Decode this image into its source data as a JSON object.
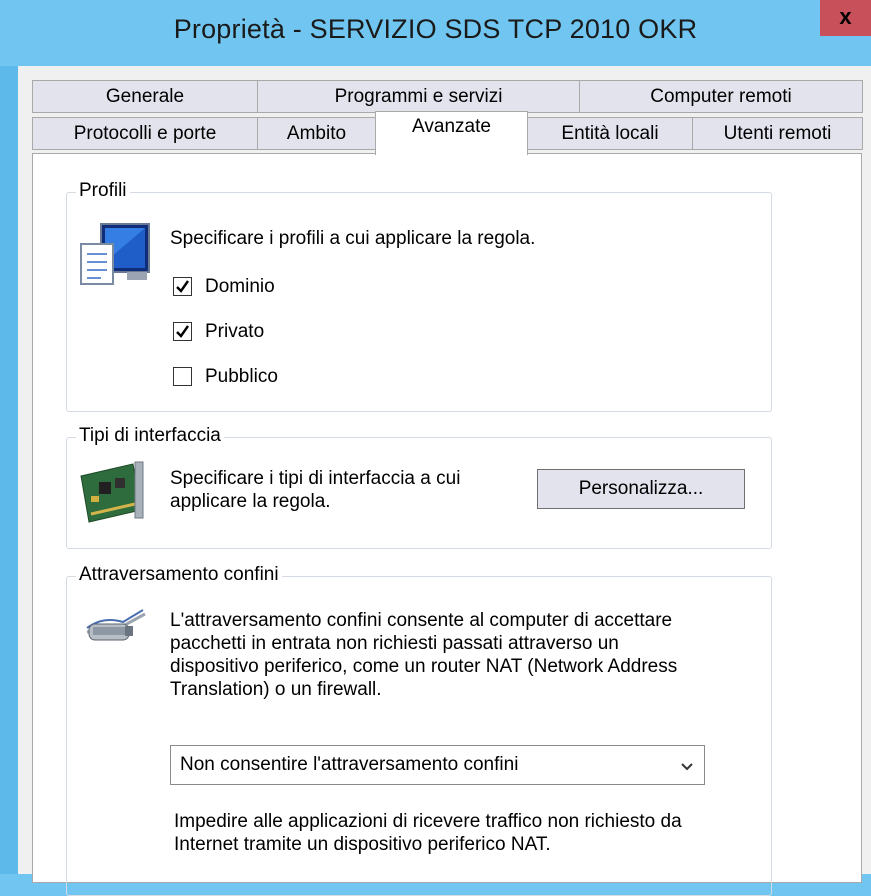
{
  "window": {
    "title": "Proprietà - SERVIZIO SDS TCP 2010 OKR",
    "close_label": "x"
  },
  "tabs": {
    "row1": [
      "Generale",
      "Programmi e servizi",
      "Computer remoti"
    ],
    "row2": [
      "Protocolli e porte",
      "Ambito",
      "Avanzate",
      "Entità locali",
      "Utenti remoti"
    ],
    "selected": "Avanzate"
  },
  "profiles": {
    "title": "Profili",
    "description": "Specificare i profili a cui applicare la regola.",
    "icon": "computer-profile-icon",
    "options": [
      {
        "label": "Dominio",
        "checked": true
      },
      {
        "label": "Privato",
        "checked": true
      },
      {
        "label": "Pubblico",
        "checked": false
      }
    ]
  },
  "interfaces": {
    "title": "Tipi di interfaccia",
    "description_line1": "Specificare i tipi di interfaccia a cui",
    "description_line2": "applicare la regola.",
    "icon": "network-card-icon",
    "button_label": "Personalizza..."
  },
  "edge_traversal": {
    "title": "Attraversamento confini",
    "icon": "network-cable-icon",
    "description_lines": [
      "L'attraversamento confini consente al computer di accettare",
      "pacchetti in entrata non richiesti passati attraverso un",
      "dispositivo periferico, come un router NAT (Network Address",
      "Translation) o un firewall."
    ],
    "selected_option": "Non consentire l'attraversamento confini",
    "help_lines": [
      "Impedire alle applicazioni di ricevere traffico non richiesto da",
      "Internet tramite un dispositivo periferico NAT."
    ]
  },
  "colors": {
    "title_bar": "#70c6f0",
    "close_button": "#c7505a",
    "tab_background": "#e3e3ee",
    "panel_background": "#ffffff"
  }
}
